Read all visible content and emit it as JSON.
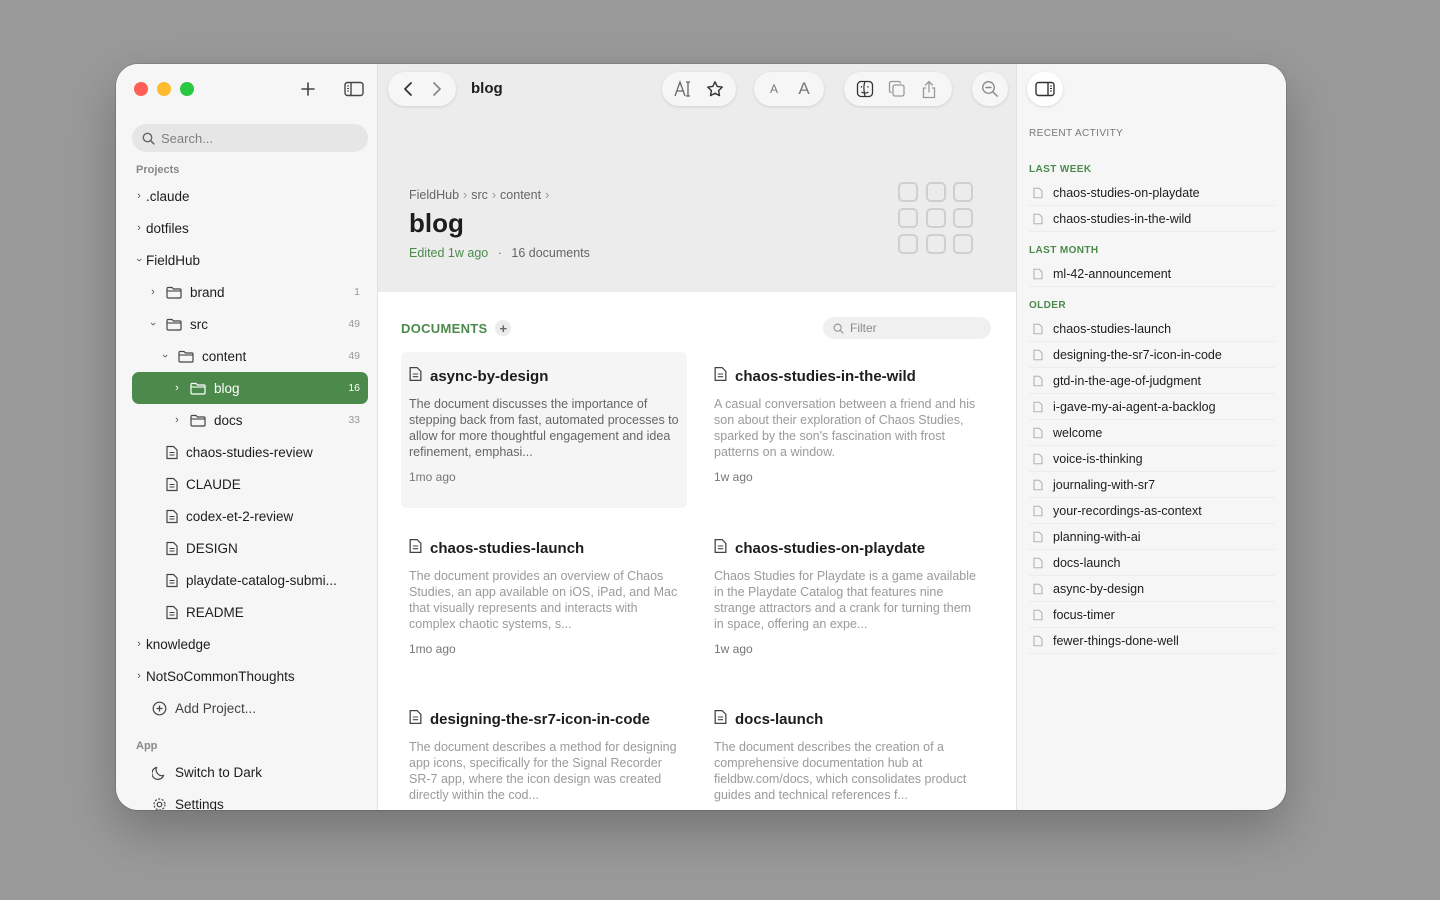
{
  "sidebar": {
    "search_placeholder": "Search...",
    "projects_label": "Projects",
    "app_label": "App",
    "tree": [
      {
        "label": ".claude"
      },
      {
        "label": "dotfiles"
      },
      {
        "label": "FieldHub"
      },
      {
        "label": "brand",
        "count": "1"
      },
      {
        "label": "src",
        "count": "49"
      },
      {
        "label": "content",
        "count": "49"
      },
      {
        "label": "blog",
        "count": "16"
      },
      {
        "label": "docs",
        "count": "33"
      },
      {
        "label": "chaos-studies-review"
      },
      {
        "label": "CLAUDE"
      },
      {
        "label": "codex-et-2-review"
      },
      {
        "label": "DESIGN"
      },
      {
        "label": "playdate-catalog-submi..."
      },
      {
        "label": "README"
      },
      {
        "label": "knowledge"
      },
      {
        "label": "NotSoCommonThoughts"
      },
      {
        "label": "Add Project..."
      }
    ],
    "app_items": [
      {
        "label": "Switch to Dark"
      },
      {
        "label": "Settings"
      }
    ]
  },
  "toolbar": {
    "title": "blog"
  },
  "header": {
    "breadcrumbs": [
      "FieldHub",
      "src",
      "content"
    ],
    "title": "blog",
    "edited": "Edited 1w ago",
    "dot": "·",
    "doc_count": "16 documents"
  },
  "documents": {
    "label": "DOCUMENTS",
    "filter_placeholder": "Filter",
    "cards": [
      {
        "title": "async-by-design",
        "desc": "The document discusses the importance of stepping back from fast, automated processes to allow for more thoughtful engagement and idea refinement, emphasi...",
        "date": "1mo ago"
      },
      {
        "title": "chaos-studies-in-the-wild",
        "desc": "A casual conversation between a friend and his son about their exploration of Chaos Studies, sparked by the son's fascination with frost patterns on a window.",
        "date": "1w ago"
      },
      {
        "title": "chaos-studies-launch",
        "desc": "The document provides an overview of Chaos Studies, an app available on iOS, iPad, and Mac that visually represents and interacts with complex chaotic systems, s...",
        "date": "1mo ago"
      },
      {
        "title": "chaos-studies-on-playdate",
        "desc": "Chaos Studies for Playdate is a game available in the Playdate Catalog that features nine strange attractors and a crank for turning them in space, offering an expe...",
        "date": "1w ago"
      },
      {
        "title": "designing-the-sr7-icon-in-code",
        "desc": "The document describes a method for designing app icons, specifically for the Signal Recorder SR-7 app, where the icon design was created directly within the cod...",
        "date": ""
      },
      {
        "title": "docs-launch",
        "desc": "The document describes the creation of a comprehensive documentation hub at fieldbw.com/docs, which consolidates product guides and technical references f...",
        "date": ""
      }
    ]
  },
  "recent": {
    "title": "RECENT ACTIVITY",
    "groups": [
      {
        "label": "LAST WEEK",
        "items": [
          "chaos-studies-on-playdate",
          "chaos-studies-in-the-wild"
        ]
      },
      {
        "label": "LAST MONTH",
        "items": [
          "ml-42-announcement"
        ]
      },
      {
        "label": "OLDER",
        "items": [
          "chaos-studies-launch",
          "designing-the-sr7-icon-in-code",
          "gtd-in-the-age-of-judgment",
          "i-gave-my-ai-agent-a-backlog",
          "welcome",
          "voice-is-thinking",
          "journaling-with-sr7",
          "your-recordings-as-context",
          "planning-with-ai",
          "docs-launch",
          "async-by-design",
          "focus-timer",
          "fewer-things-done-well"
        ]
      }
    ]
  },
  "colors": {
    "accent": "#4c8a4c",
    "close": "#ff5f57",
    "minimize": "#febc2e",
    "zoom": "#28c840"
  }
}
